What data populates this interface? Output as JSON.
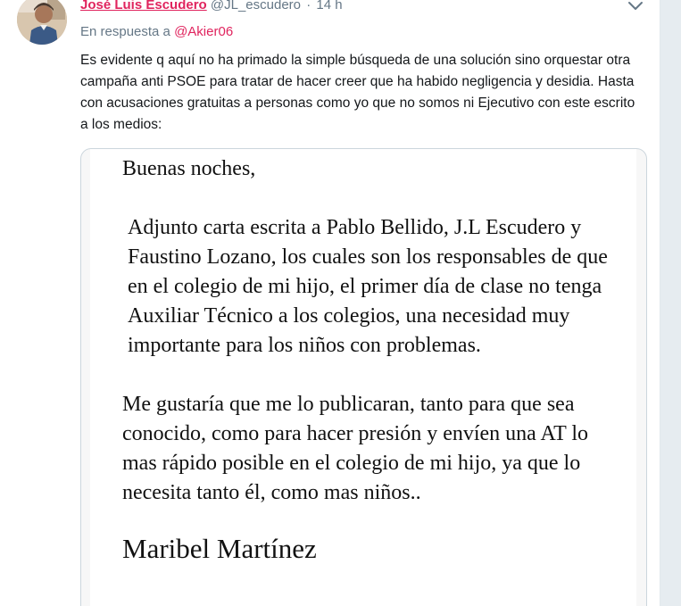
{
  "tweet": {
    "author_name": "José Luis Escudero",
    "author_handle": "@JL_escudero",
    "separator": "·",
    "time": "14 h",
    "reply_prefix": "En respuesta a",
    "reply_to": "@Akier06",
    "text": "Es evidente q aquí no ha primado la simple búsqueda de una solución sino orquestar otra campaña anti PSOE para tratar de hacer creer que ha habido negligencia y desidia. Hasta con acusaciones gratuitas a personas como yo que no somos ni Ejecutivo con este escrito a los medios:"
  },
  "letter": {
    "greeting": "Buenas noches,",
    "paragraph1": "Adjunto carta escrita a Pablo Bellido, J.L Escudero y Faustino Lozano, los cuales son los responsables de que en el colegio de mi hijo, el primer día de clase no tenga  Auxiliar Técnico a los colegios, una necesidad muy importante para los niños con problemas.",
    "paragraph2": "Me gustaría que me lo publicaran, tanto para que sea conocido, como para hacer presión y envíen una AT lo mas rápido posible en el colegio de mi hijo, ya que lo necesita tanto él, como mas niños..",
    "signature": "Maribel Martínez"
  },
  "icons": {
    "avatar": "profile-photo",
    "menu": "chevron-down-icon"
  },
  "colors": {
    "accent": "#e0245e",
    "muted": "#657786",
    "text": "#14171a",
    "border": "#ccd6dd"
  }
}
